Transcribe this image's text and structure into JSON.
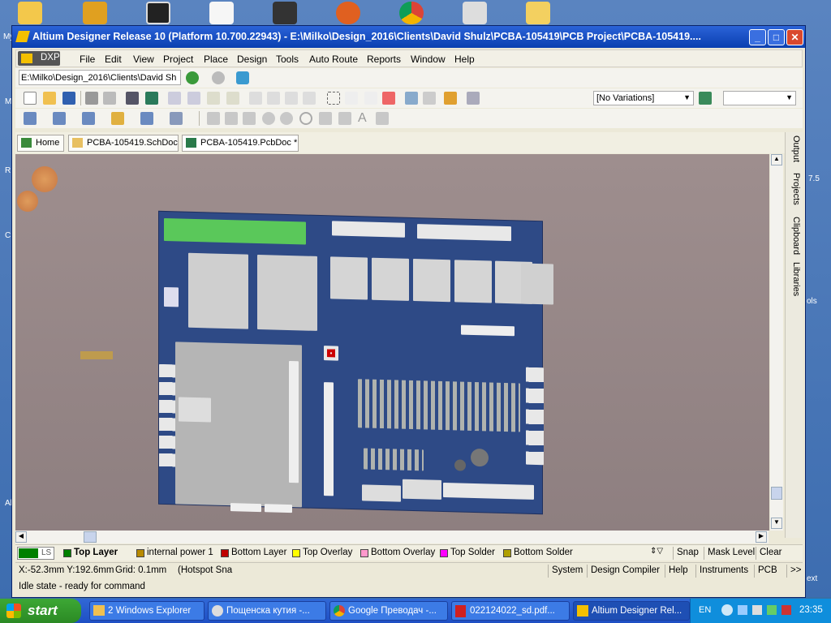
{
  "window": {
    "title": "Altium Designer Release 10 (Platform 10.700.22943) - E:\\Milko\\Design_2016\\Clients\\David Shulz\\PCBA-105419\\PCB Project\\PCBA-105419....",
    "min": "_",
    "max": "□",
    "close": "✕"
  },
  "menu": {
    "dxp": "DXP",
    "items": [
      "File",
      "Edit",
      "View",
      "Project",
      "Place",
      "Design",
      "Tools",
      "Auto Route",
      "Reports",
      "Window",
      "Help"
    ]
  },
  "navbar": {
    "path": "E:\\Milko\\Design_2016\\Clients\\David Sh"
  },
  "variations": {
    "selected": "[No Variations]"
  },
  "tabs": {
    "home": "Home",
    "sch": "PCBA-105419.SchDoc",
    "pcb": "PCBA-105419.PcbDoc *"
  },
  "panels": [
    "Output",
    "Projects",
    "Clipboard",
    "Libraries"
  ],
  "layers": {
    "ls": "LS",
    "items": [
      {
        "label": "Top Layer",
        "color": "#008000"
      },
      {
        "label": "internal power 1",
        "color": "#b88a00"
      },
      {
        "label": "Bottom Layer",
        "color": "#c00000"
      },
      {
        "label": "Top Overlay",
        "color": "#ffff00"
      },
      {
        "label": "Bottom Overlay",
        "color": "#ff99cc"
      },
      {
        "label": "Top Solder",
        "color": "#ff00ff"
      },
      {
        "label": "Bottom Solder",
        "color": "#b0a000"
      }
    ],
    "snap": "Snap",
    "mask": "Mask Level",
    "clear": "Clear"
  },
  "status": {
    "coords": "X:-52.3mm Y:192.6mm",
    "grid": "Grid: 0.1mm",
    "hotspot": "(Hotspot Sna",
    "idle": "Idle state - ready for command",
    "buttons": [
      "System",
      "Design Compiler",
      "Help",
      "Instruments",
      "PCB"
    ],
    "more": ">>"
  },
  "taskbar": {
    "start": "start",
    "tasks": [
      "2 Windows Explorer",
      "Пощенска кутия -...",
      "Google Преводач -...",
      "022124022_sd.pdf...",
      "Altium Designer Rel..."
    ],
    "lang": "EN",
    "clock": "23:35"
  },
  "desktop_labels": [
    "My",
    "M",
    "R",
    "C",
    "Al",
    "7.5",
    "ols",
    "ext"
  ]
}
